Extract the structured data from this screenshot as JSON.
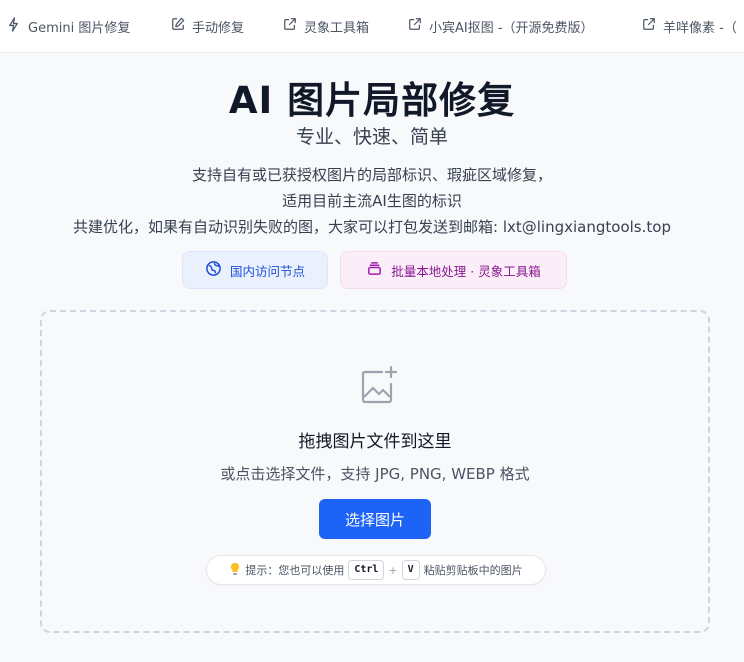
{
  "nav": {
    "items": [
      {
        "label": "Gemini 图片修复",
        "icon": "sparkle-icon"
      },
      {
        "label": "手动修复",
        "icon": "edit-icon"
      },
      {
        "label": "灵象工具箱",
        "icon": "external-link-icon"
      },
      {
        "label": "小宾AI抠图 -（开源免费版）",
        "icon": "external-link-icon"
      },
      {
        "label": "羊咩像素 -（",
        "icon": "external-link-icon"
      }
    ]
  },
  "hero": {
    "title": "AI 图片局部修复",
    "subtitle": "专业、快速、简单",
    "desc1": "支持自有或已获授权图片的局部标识、瑕疵区域修复，",
    "desc2": "适用目前主流AI生图的标识",
    "desc3": "共建优化，如果有自动识别失败的图，大家可以打包发送到邮箱: lxt@lingxiangtools.top"
  },
  "pills": {
    "domestic_label": "国内访问节点",
    "domestic_icon": "globe-icon",
    "batch_label": "批量本地处理 · 灵象工具箱",
    "batch_icon": "stack-icon"
  },
  "dropzone": {
    "icon": "image-add-icon",
    "title": "拖拽图片文件到这里",
    "subtitle": "或点击选择文件，支持 JPG, PNG, WEBP 格式",
    "button_label": "选择图片"
  },
  "tip": {
    "icon": "lightbulb-icon",
    "prefix": "提示：您也可以使用",
    "key1": "Ctrl",
    "plus": "+",
    "key2": "V",
    "suffix": "粘贴剪贴板中的图片"
  },
  "colors": {
    "primary": "#1d63f5",
    "pill_blue_bg": "#eaf1fd",
    "pill_pink_bg": "#fbeef8"
  }
}
